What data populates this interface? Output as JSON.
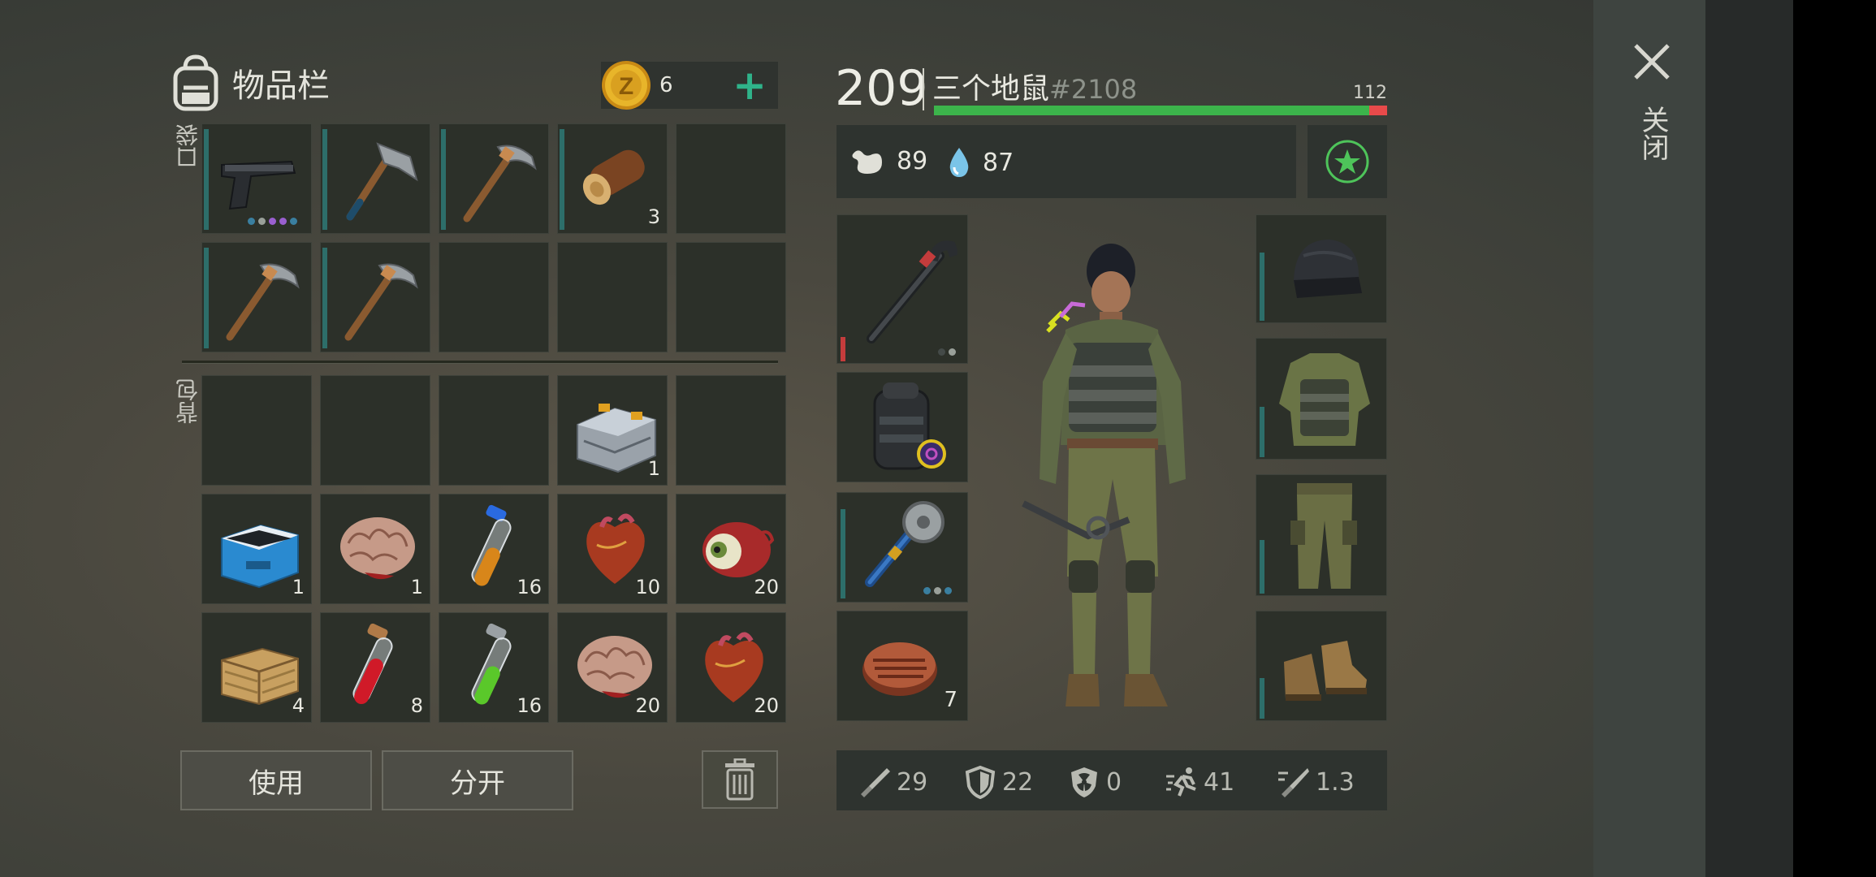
{
  "inventory": {
    "title": "物品栏",
    "coins": {
      "count": "6",
      "plus": "+"
    },
    "pocket_label": "口袋",
    "backpack_label": "背包",
    "pocket_items": [
      {
        "icon": "pistol-icon",
        "qty": "",
        "dots": [
          "#3a7fa0",
          "#9aa09a",
          "#9a5fd0",
          "#9a5fd0",
          "#3a7fa0"
        ]
      },
      {
        "icon": "axe-icon",
        "qty": ""
      },
      {
        "icon": "pickaxe-icon",
        "qty": ""
      },
      {
        "icon": "log-icon",
        "qty": "3"
      },
      {
        "icon": "",
        "qty": ""
      },
      {
        "icon": "pickaxe-icon",
        "qty": ""
      },
      {
        "icon": "pickaxe-icon",
        "qty": ""
      },
      {
        "icon": "",
        "qty": ""
      },
      {
        "icon": "",
        "qty": ""
      },
      {
        "icon": "",
        "qty": ""
      }
    ],
    "backpack_items": [
      {
        "icon": "",
        "qty": ""
      },
      {
        "icon": "",
        "qty": ""
      },
      {
        "icon": "",
        "qty": ""
      },
      {
        "icon": "toolbox-icon",
        "qty": "1"
      },
      {
        "icon": "",
        "qty": ""
      },
      {
        "icon": "cooler-icon",
        "qty": "1"
      },
      {
        "icon": "brain-icon",
        "qty": "1"
      },
      {
        "icon": "orange-vial-icon",
        "qty": "16"
      },
      {
        "icon": "heart-icon",
        "qty": "10"
      },
      {
        "icon": "eyeball-icon",
        "qty": "20"
      },
      {
        "icon": "crate-icon",
        "qty": "4"
      },
      {
        "icon": "red-vial-icon",
        "qty": "8"
      },
      {
        "icon": "green-vial-icon",
        "qty": "16"
      },
      {
        "icon": "brain-icon",
        "qty": "20"
      },
      {
        "icon": "heart-icon",
        "qty": "20"
      }
    ],
    "use_label": "使用",
    "split_label": "分开"
  },
  "character": {
    "level": "209",
    "name": "三个地鼠",
    "id": "#2108",
    "hp": "112",
    "hp_fraction": 0.96,
    "food": "89",
    "water": "87",
    "weapon_slots": [
      {
        "icon": "crowbar-icon",
        "qty": ""
      },
      {
        "icon": "backpack-icon",
        "qty": ""
      },
      {
        "icon": "saw-mace-icon",
        "qty": ""
      },
      {
        "icon": "steak-icon",
        "qty": "7"
      }
    ],
    "armor_slots": [
      "beanie-icon",
      "vest-icon",
      "pants-icon",
      "boots-icon"
    ],
    "stats": {
      "attack": "29",
      "defense": "22",
      "radiation": "0",
      "speed": "41",
      "attack_speed": "1.3"
    }
  },
  "close_label": "关闭",
  "colors": {
    "accent_teal": "#2d6e6a",
    "health_green": "#3cb44b",
    "health_red": "#e84a4a",
    "coin_gold": "#e0a828",
    "plus_green": "#2fb38a"
  }
}
